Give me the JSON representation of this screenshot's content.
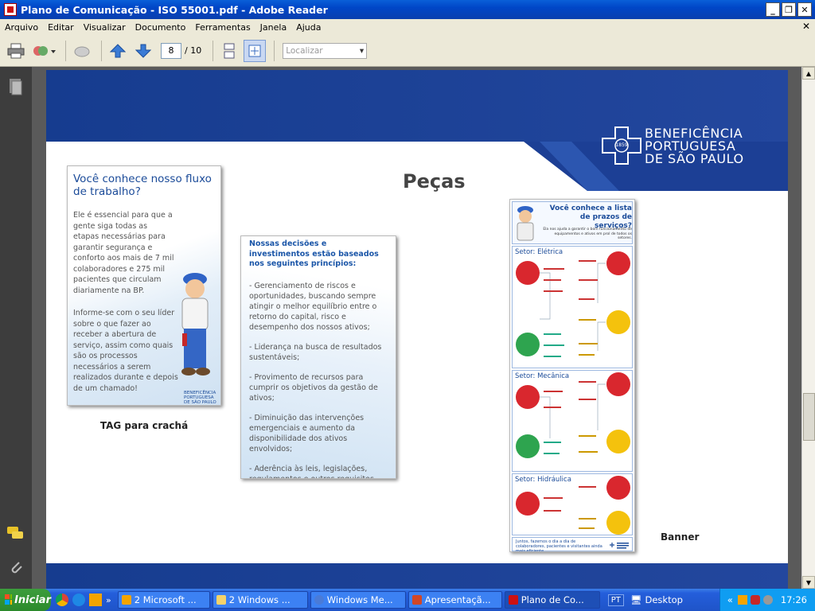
{
  "window": {
    "title": "Plano de Comunicação - ISO 55001.pdf - Adobe Reader"
  },
  "menu": [
    "Arquivo",
    "Editar",
    "Visualizar",
    "Documento",
    "Ferramentas",
    "Janela",
    "Ajuda"
  ],
  "toolbar": {
    "page_current": "8",
    "page_total": "/ 10",
    "find_placeholder": "Localizar"
  },
  "slide": {
    "title": "Peças",
    "logo_line1": "BENEFICÊNCIA",
    "logo_line2": "PORTUGUESA",
    "logo_line3": "DE SÃO PAULO",
    "logo_year": "1859",
    "tag_heading": "Você conhece nosso fluxo de trabalho?",
    "tag_p1": "Ele é essencial para que a gente siga todas as etapas necessárias para garantir segurança e conforto aos mais de 7 mil colaboradores e 275 mil pacientes que circulam diariamente na BP.",
    "tag_p2": "Informe-se com o seu líder sobre o que fazer ao receber a abertura de serviço, assim como quais são os processos necessários a serem realizados durante e depois de um chamado!",
    "tag_logo": "BENEFICÊNCIA PORTUGUESA DE SÃO PAULO",
    "tag_caption": "TAG para crachá",
    "policy_heading": "Nossas decisões e investimentos estão baseados nos seguintes princípios:",
    "policy_items": [
      "- Gerenciamento de riscos e oportunidades, buscando sempre atingir o melhor equilíbrio entre o retorno do capital, risco e desempenho dos nossos ativos;",
      "- Liderança na busca de resultados sustentáveis;",
      "- Provimento de recursos para cumprir os objetivos da gestão de ativos;",
      "- Diminuição das intervenções emergenciais e aumento da disponibilidade dos ativos envolvidos;",
      "- Aderência às leis, legislações, regulamentos e outros requisitos subscritos."
    ],
    "banner_title": "Você conhece a lista de prazos de serviços?",
    "banner_sub": "Ela nos ajuda a garantir o bom funcionamento de equipamentos e ativos em prol de todos os setores.",
    "banner_sectors": [
      "Setor: Elétrica",
      "Setor: Mecânica",
      "Setor: Hidráulica"
    ],
    "banner_footer": "Juntos, fazemos o dia a dia de colaboradores, pacientes e visitantes ainda mais eficiente.",
    "banner_caption": "Banner"
  },
  "taskbar": {
    "start": "Iniciar",
    "tasks": [
      "2 Microsoft ...",
      "2 Windows ...",
      "Windows Me...",
      "Apresentaçã...",
      "Plano de Co..."
    ],
    "lang": "PT",
    "desktop": "Desktop",
    "clock": "17:26"
  },
  "colors": {
    "title_bar": "#0a5fd8",
    "slide_blue": "#1c3a8a",
    "accent_red": "#d9272e",
    "accent_yellow": "#f4c20d",
    "accent_green": "#2ea44f"
  }
}
